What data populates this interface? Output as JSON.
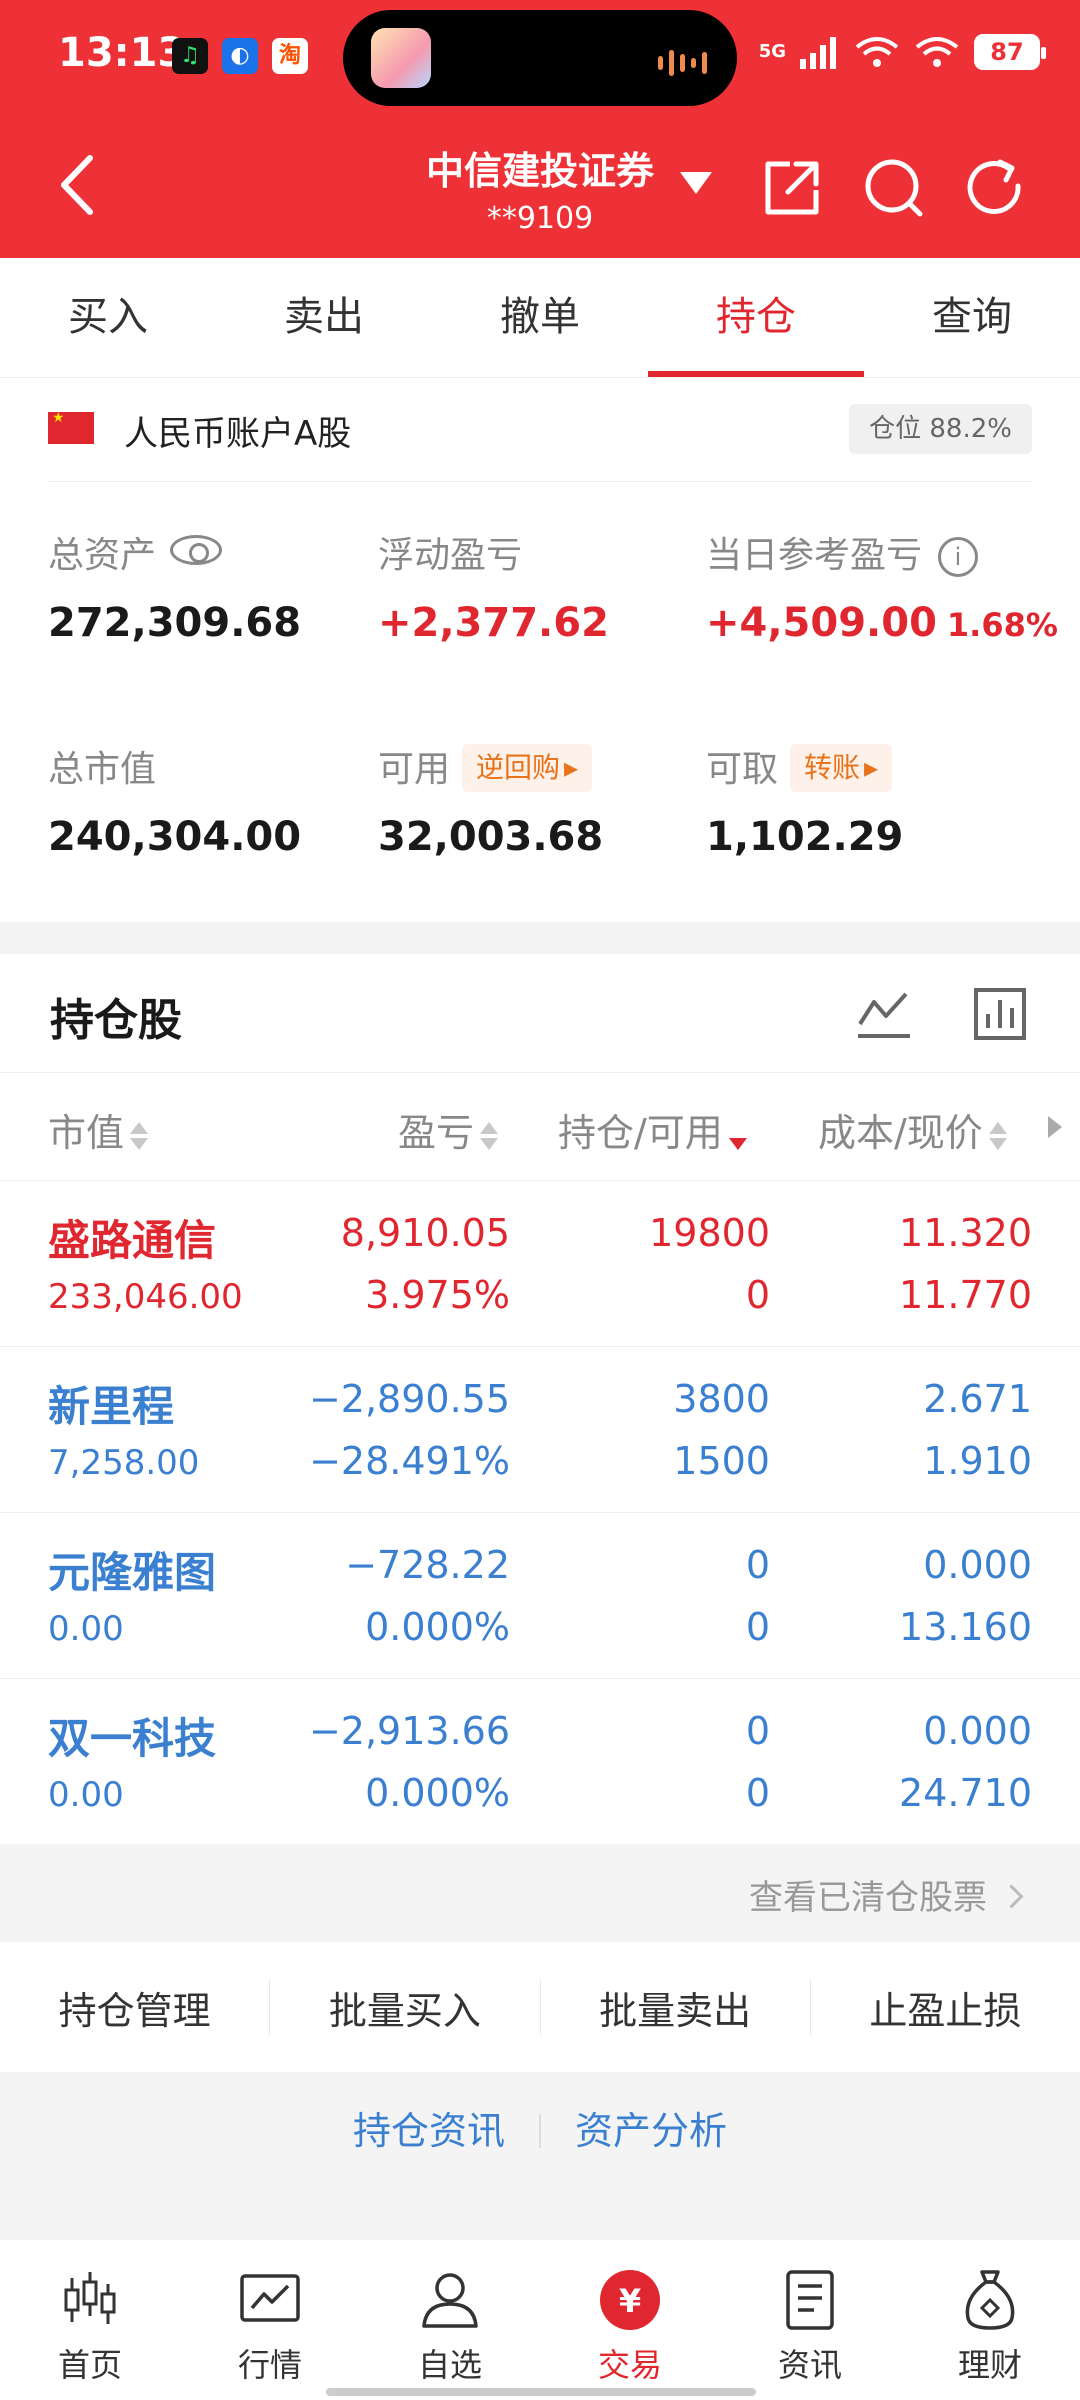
{
  "status_bar": {
    "time": "13:13",
    "battery": "87",
    "network": "5G",
    "notifications": [
      "♫",
      "◐",
      "淘"
    ]
  },
  "header": {
    "broker_name": "中信建投证券",
    "account": "**9109"
  },
  "tabs": [
    {
      "label": "买入",
      "active": false
    },
    {
      "label": "卖出",
      "active": false
    },
    {
      "label": "撤单",
      "active": false
    },
    {
      "label": "持仓",
      "active": true
    },
    {
      "label": "查询",
      "active": false
    }
  ],
  "account": {
    "label": "人民币账户A股",
    "position_ratio": "仓位 88.2%"
  },
  "summary": {
    "total_assets_label": "总资产",
    "total_assets": "272,309.68",
    "floating_pl_label": "浮动盈亏",
    "floating_pl": "+2,377.62",
    "daily_pl_label": "当日参考盈亏",
    "daily_pl": "+4,509.00",
    "daily_pl_pct": "1.68%",
    "market_value_label": "总市值",
    "market_value": "240,304.00",
    "available_label": "可用",
    "available": "32,003.68",
    "available_tag": "逆回购",
    "withdrawable_label": "可取",
    "withdrawable": "1,102.29",
    "withdrawable_tag": "转账"
  },
  "holdings": {
    "title": "持仓股",
    "columns": [
      "市值",
      "盈亏",
      "持仓/可用",
      "成本/现价"
    ],
    "rows": [
      {
        "name": "盛路通信",
        "market_value": "233,046.00",
        "pl": "8,910.05",
        "pl_pct": "3.975%",
        "qty": "19800",
        "available": "0",
        "cost": "11.320",
        "price": "11.770",
        "tone": "red"
      },
      {
        "name": "新里程",
        "market_value": "7,258.00",
        "pl": "−2,890.55",
        "pl_pct": "−28.491%",
        "qty": "3800",
        "available": "1500",
        "cost": "2.671",
        "price": "1.910",
        "tone": "blue"
      },
      {
        "name": "元隆雅图",
        "market_value": "0.00",
        "pl": "−728.22",
        "pl_pct": "0.000%",
        "qty": "0",
        "available": "0",
        "cost": "0.000",
        "price": "13.160",
        "tone": "blue"
      },
      {
        "name": "双一科技",
        "market_value": "0.00",
        "pl": "−2,913.66",
        "pl_pct": "0.000%",
        "qty": "0",
        "available": "0",
        "cost": "0.000",
        "price": "24.710",
        "tone": "blue"
      }
    ],
    "cleared_link": "查看已清仓股票"
  },
  "actions": [
    "持仓管理",
    "批量买入",
    "批量卖出",
    "止盈止损"
  ],
  "links": [
    "持仓资讯",
    "资产分析"
  ],
  "bottom_nav": [
    {
      "label": "首页",
      "icon": "candlestick-icon",
      "active": false
    },
    {
      "label": "行情",
      "icon": "chart-line-icon",
      "active": false
    },
    {
      "label": "自选",
      "icon": "user-icon",
      "active": false
    },
    {
      "label": "交易",
      "icon": "yen-icon",
      "active": true
    },
    {
      "label": "资讯",
      "icon": "document-icon",
      "active": false
    },
    {
      "label": "理财",
      "icon": "money-bag-icon",
      "active": false
    }
  ],
  "colors": {
    "brand_red": "#ee3136",
    "gain": "#e0262e",
    "loss": "#3a7fd0",
    "tag_orange": "#e8731a"
  }
}
